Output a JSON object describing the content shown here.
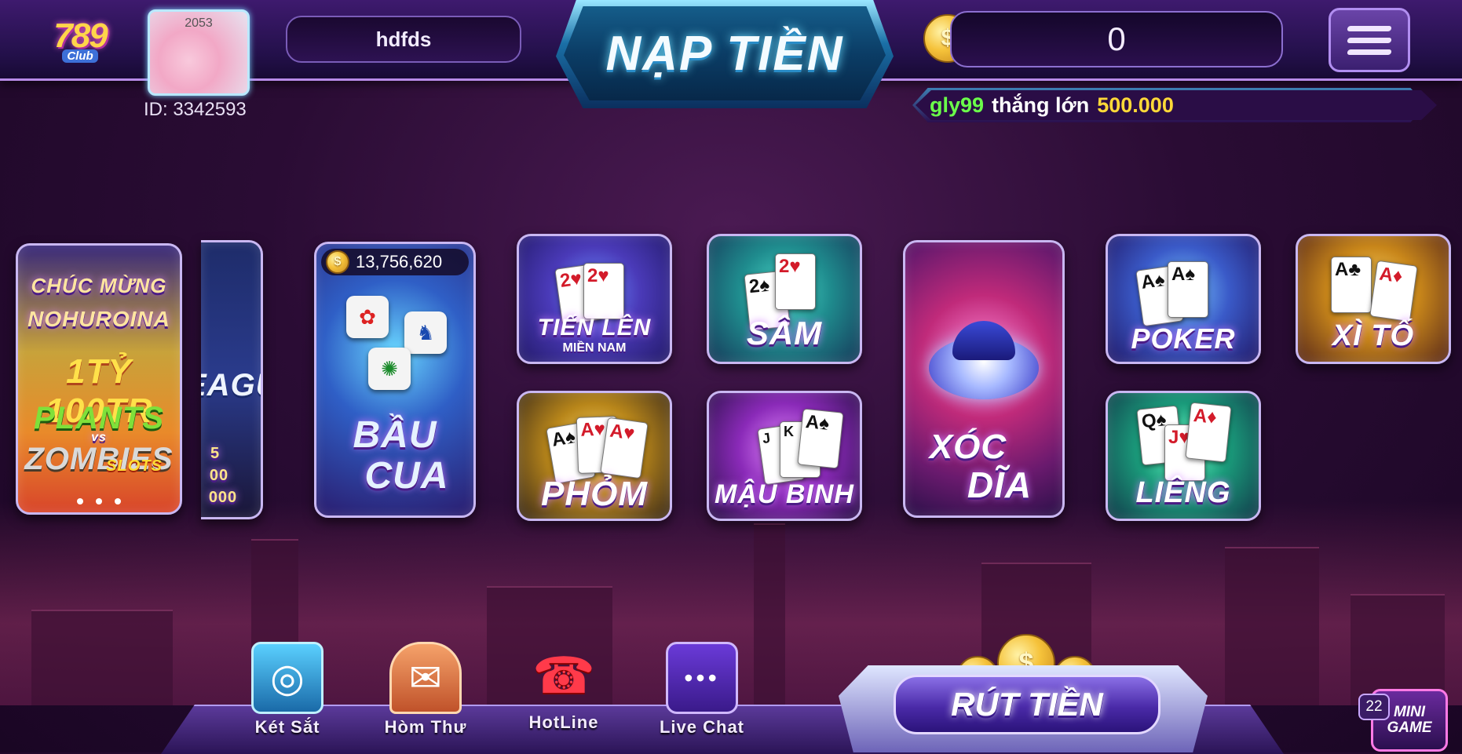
{
  "logo": {
    "number": "789",
    "word": "Club"
  },
  "user": {
    "avatar_level": "2053",
    "id_label": "ID: 3342593",
    "name": "hdfds"
  },
  "deposit": {
    "label": "NẠP TIỀN"
  },
  "balance": {
    "coin_symbol": "$",
    "value": "0"
  },
  "ticker": {
    "user": "gly99",
    "message": "thắng lớn",
    "amount": "500.000"
  },
  "banners": {
    "promo": {
      "line1": "CHÚC MỪNG",
      "line2": "NOHUROINA",
      "line3": "1TỶ 100TR",
      "line4": "PLANTS",
      "line5": "vs",
      "line6": "ZOMBIES",
      "line7": "SLOTS"
    },
    "league": {
      "title": "EAGUE",
      "line1": "5",
      "line2": "00",
      "line3": "000"
    }
  },
  "games": {
    "bau_cua": {
      "jackpot": "13,756,620",
      "line1": "BẦU",
      "line2": "CUA"
    },
    "tien_len": {
      "line1": "TIẾN LÊN",
      "line2": "MIỀN NAM"
    },
    "sam": {
      "title": "SÂM"
    },
    "xoc_dia": {
      "line1": "XÓC",
      "line2": "DĨA"
    },
    "poker": {
      "title": "POKER"
    },
    "xi_to": {
      "title": "XÌ TỐ"
    },
    "phom": {
      "title": "PHỎM"
    },
    "mau_binh": {
      "title": "MẬU BINH"
    },
    "lieng": {
      "title": "LIÊNG"
    }
  },
  "bottom_nav": {
    "safe": "Két Sắt",
    "mail": "Hòm Thư",
    "hotline": "HotLine",
    "livechat": "Live Chat"
  },
  "withdraw": {
    "label": "RÚT TIỀN"
  },
  "minigame": {
    "badge": "22",
    "line1": "MINI",
    "line2": "GAME"
  },
  "colors": {
    "accent": "#b88be8",
    "ticker_user": "#6bff4a",
    "ticker_amount": "#ffd938"
  }
}
